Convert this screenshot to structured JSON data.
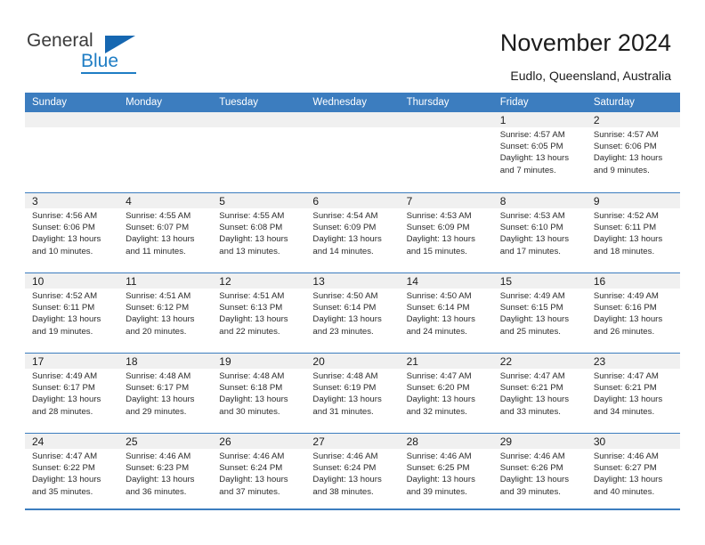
{
  "brand": {
    "name_part1": "General",
    "name_part2": "Blue",
    "color_dark": "#3b3b3b",
    "color_blue": "#1e7dc4"
  },
  "header": {
    "title": "November 2024",
    "subtitle": "Eudlo, Queensland, Australia"
  },
  "theme": {
    "header_blue": "#3c7dbf",
    "band_gray": "#f0f0f0",
    "text": "#1c1c1c"
  },
  "weekdays": [
    "Sunday",
    "Monday",
    "Tuesday",
    "Wednesday",
    "Thursday",
    "Friday",
    "Saturday"
  ],
  "weeks": [
    [
      {
        "day": "",
        "sunrise": "",
        "sunset": "",
        "daylight1": "",
        "daylight2": ""
      },
      {
        "day": "",
        "sunrise": "",
        "sunset": "",
        "daylight1": "",
        "daylight2": ""
      },
      {
        "day": "",
        "sunrise": "",
        "sunset": "",
        "daylight1": "",
        "daylight2": ""
      },
      {
        "day": "",
        "sunrise": "",
        "sunset": "",
        "daylight1": "",
        "daylight2": ""
      },
      {
        "day": "",
        "sunrise": "",
        "sunset": "",
        "daylight1": "",
        "daylight2": ""
      },
      {
        "day": "1",
        "sunrise": "Sunrise: 4:57 AM",
        "sunset": "Sunset: 6:05 PM",
        "daylight1": "Daylight: 13 hours",
        "daylight2": "and 7 minutes."
      },
      {
        "day": "2",
        "sunrise": "Sunrise: 4:57 AM",
        "sunset": "Sunset: 6:06 PM",
        "daylight1": "Daylight: 13 hours",
        "daylight2": "and 9 minutes."
      }
    ],
    [
      {
        "day": "3",
        "sunrise": "Sunrise: 4:56 AM",
        "sunset": "Sunset: 6:06 PM",
        "daylight1": "Daylight: 13 hours",
        "daylight2": "and 10 minutes."
      },
      {
        "day": "4",
        "sunrise": "Sunrise: 4:55 AM",
        "sunset": "Sunset: 6:07 PM",
        "daylight1": "Daylight: 13 hours",
        "daylight2": "and 11 minutes."
      },
      {
        "day": "5",
        "sunrise": "Sunrise: 4:55 AM",
        "sunset": "Sunset: 6:08 PM",
        "daylight1": "Daylight: 13 hours",
        "daylight2": "and 13 minutes."
      },
      {
        "day": "6",
        "sunrise": "Sunrise: 4:54 AM",
        "sunset": "Sunset: 6:09 PM",
        "daylight1": "Daylight: 13 hours",
        "daylight2": "and 14 minutes."
      },
      {
        "day": "7",
        "sunrise": "Sunrise: 4:53 AM",
        "sunset": "Sunset: 6:09 PM",
        "daylight1": "Daylight: 13 hours",
        "daylight2": "and 15 minutes."
      },
      {
        "day": "8",
        "sunrise": "Sunrise: 4:53 AM",
        "sunset": "Sunset: 6:10 PM",
        "daylight1": "Daylight: 13 hours",
        "daylight2": "and 17 minutes."
      },
      {
        "day": "9",
        "sunrise": "Sunrise: 4:52 AM",
        "sunset": "Sunset: 6:11 PM",
        "daylight1": "Daylight: 13 hours",
        "daylight2": "and 18 minutes."
      }
    ],
    [
      {
        "day": "10",
        "sunrise": "Sunrise: 4:52 AM",
        "sunset": "Sunset: 6:11 PM",
        "daylight1": "Daylight: 13 hours",
        "daylight2": "and 19 minutes."
      },
      {
        "day": "11",
        "sunrise": "Sunrise: 4:51 AM",
        "sunset": "Sunset: 6:12 PM",
        "daylight1": "Daylight: 13 hours",
        "daylight2": "and 20 minutes."
      },
      {
        "day": "12",
        "sunrise": "Sunrise: 4:51 AM",
        "sunset": "Sunset: 6:13 PM",
        "daylight1": "Daylight: 13 hours",
        "daylight2": "and 22 minutes."
      },
      {
        "day": "13",
        "sunrise": "Sunrise: 4:50 AM",
        "sunset": "Sunset: 6:14 PM",
        "daylight1": "Daylight: 13 hours",
        "daylight2": "and 23 minutes."
      },
      {
        "day": "14",
        "sunrise": "Sunrise: 4:50 AM",
        "sunset": "Sunset: 6:14 PM",
        "daylight1": "Daylight: 13 hours",
        "daylight2": "and 24 minutes."
      },
      {
        "day": "15",
        "sunrise": "Sunrise: 4:49 AM",
        "sunset": "Sunset: 6:15 PM",
        "daylight1": "Daylight: 13 hours",
        "daylight2": "and 25 minutes."
      },
      {
        "day": "16",
        "sunrise": "Sunrise: 4:49 AM",
        "sunset": "Sunset: 6:16 PM",
        "daylight1": "Daylight: 13 hours",
        "daylight2": "and 26 minutes."
      }
    ],
    [
      {
        "day": "17",
        "sunrise": "Sunrise: 4:49 AM",
        "sunset": "Sunset: 6:17 PM",
        "daylight1": "Daylight: 13 hours",
        "daylight2": "and 28 minutes."
      },
      {
        "day": "18",
        "sunrise": "Sunrise: 4:48 AM",
        "sunset": "Sunset: 6:17 PM",
        "daylight1": "Daylight: 13 hours",
        "daylight2": "and 29 minutes."
      },
      {
        "day": "19",
        "sunrise": "Sunrise: 4:48 AM",
        "sunset": "Sunset: 6:18 PM",
        "daylight1": "Daylight: 13 hours",
        "daylight2": "and 30 minutes."
      },
      {
        "day": "20",
        "sunrise": "Sunrise: 4:48 AM",
        "sunset": "Sunset: 6:19 PM",
        "daylight1": "Daylight: 13 hours",
        "daylight2": "and 31 minutes."
      },
      {
        "day": "21",
        "sunrise": "Sunrise: 4:47 AM",
        "sunset": "Sunset: 6:20 PM",
        "daylight1": "Daylight: 13 hours",
        "daylight2": "and 32 minutes."
      },
      {
        "day": "22",
        "sunrise": "Sunrise: 4:47 AM",
        "sunset": "Sunset: 6:21 PM",
        "daylight1": "Daylight: 13 hours",
        "daylight2": "and 33 minutes."
      },
      {
        "day": "23",
        "sunrise": "Sunrise: 4:47 AM",
        "sunset": "Sunset: 6:21 PM",
        "daylight1": "Daylight: 13 hours",
        "daylight2": "and 34 minutes."
      }
    ],
    [
      {
        "day": "24",
        "sunrise": "Sunrise: 4:47 AM",
        "sunset": "Sunset: 6:22 PM",
        "daylight1": "Daylight: 13 hours",
        "daylight2": "and 35 minutes."
      },
      {
        "day": "25",
        "sunrise": "Sunrise: 4:46 AM",
        "sunset": "Sunset: 6:23 PM",
        "daylight1": "Daylight: 13 hours",
        "daylight2": "and 36 minutes."
      },
      {
        "day": "26",
        "sunrise": "Sunrise: 4:46 AM",
        "sunset": "Sunset: 6:24 PM",
        "daylight1": "Daylight: 13 hours",
        "daylight2": "and 37 minutes."
      },
      {
        "day": "27",
        "sunrise": "Sunrise: 4:46 AM",
        "sunset": "Sunset: 6:24 PM",
        "daylight1": "Daylight: 13 hours",
        "daylight2": "and 38 minutes."
      },
      {
        "day": "28",
        "sunrise": "Sunrise: 4:46 AM",
        "sunset": "Sunset: 6:25 PM",
        "daylight1": "Daylight: 13 hours",
        "daylight2": "and 39 minutes."
      },
      {
        "day": "29",
        "sunrise": "Sunrise: 4:46 AM",
        "sunset": "Sunset: 6:26 PM",
        "daylight1": "Daylight: 13 hours",
        "daylight2": "and 39 minutes."
      },
      {
        "day": "30",
        "sunrise": "Sunrise: 4:46 AM",
        "sunset": "Sunset: 6:27 PM",
        "daylight1": "Daylight: 13 hours",
        "daylight2": "and 40 minutes."
      }
    ]
  ]
}
